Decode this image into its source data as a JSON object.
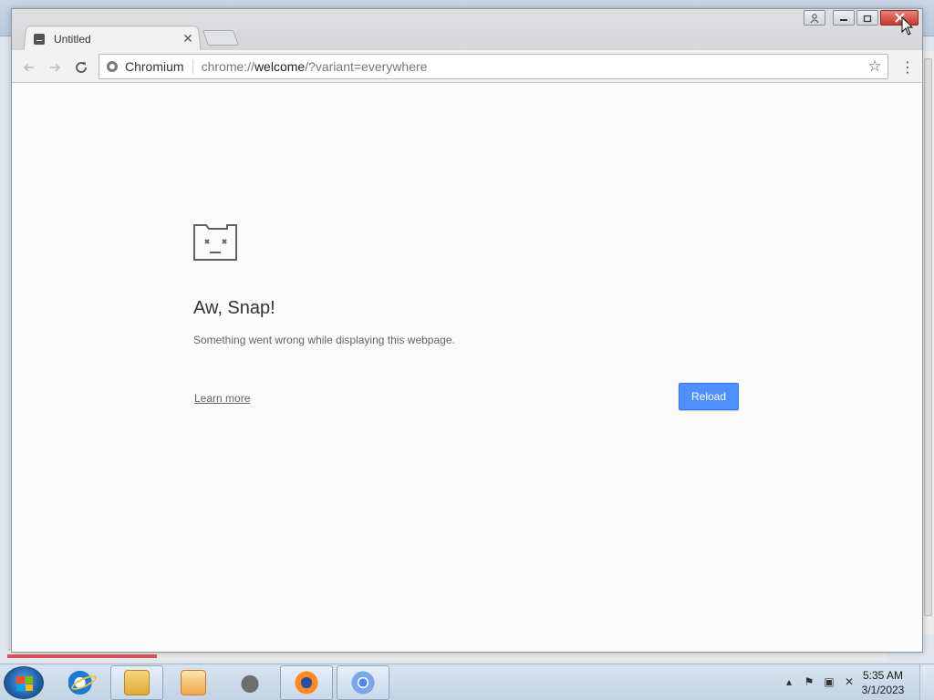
{
  "browser": {
    "tab": {
      "title": "Untitled",
      "close_symbol": "✕"
    },
    "omnibox": {
      "site_chip": "Chromium",
      "url_prefix": "chrome://",
      "url_host": "welcome",
      "url_suffix": "/?variant=everywhere"
    },
    "icons": {
      "back": "back-arrow-icon",
      "forward": "forward-arrow-icon",
      "reload": "reload-icon",
      "star": "bookmark-star-icon",
      "menu": "kebab-menu-icon"
    }
  },
  "error_page": {
    "headline": "Aw, Snap!",
    "message": "Something went wrong while displaying this webpage.",
    "learn_more": "Learn more",
    "reload_button": "Reload",
    "accent_color": "#4d90fe"
  },
  "taskbar": {
    "clock_time": "5:35 AM",
    "clock_date": "3/1/2023",
    "pinned_apps": [
      "internet-explorer",
      "file-explorer",
      "media-player",
      "raccoon-app",
      "firefox",
      "chromium"
    ],
    "active_app": "chromium"
  }
}
